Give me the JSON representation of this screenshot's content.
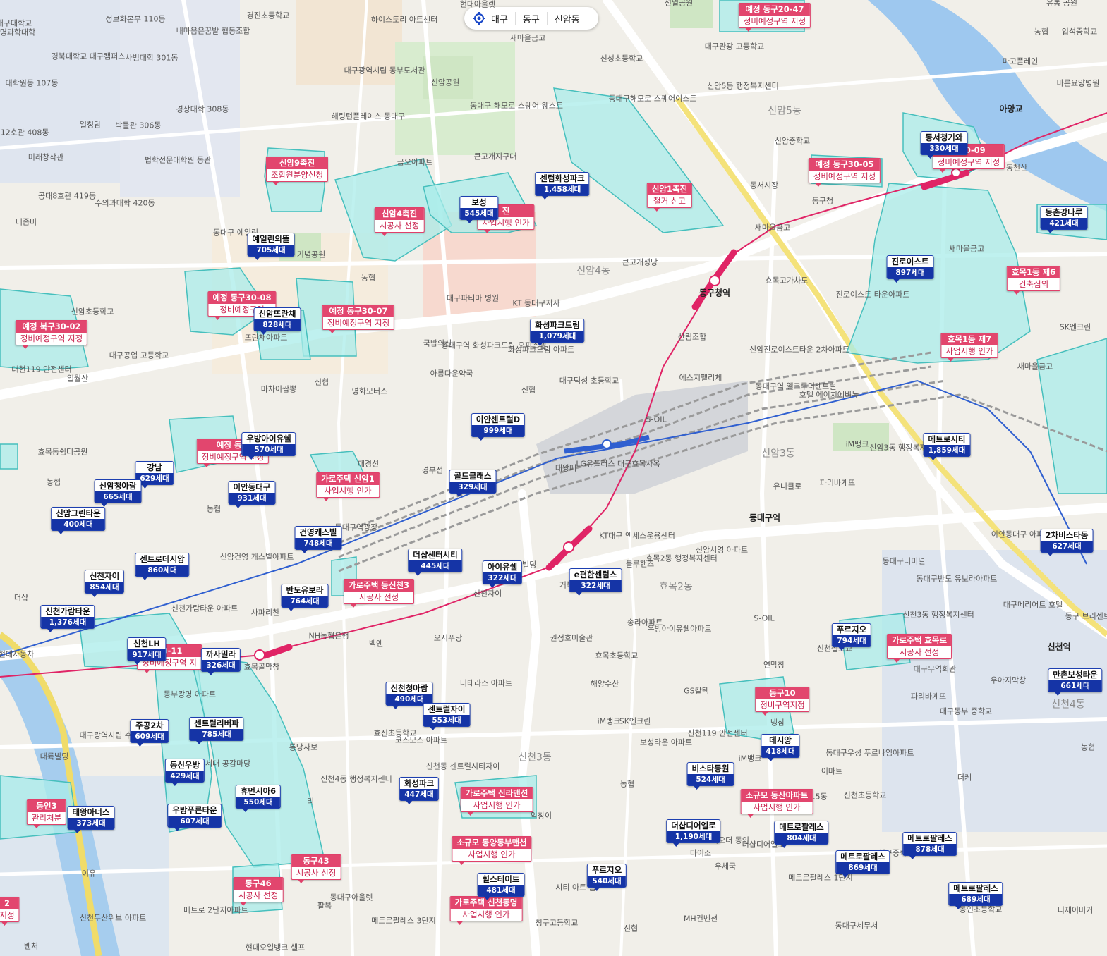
{
  "breadcrumb": {
    "icon": "location-target-icon",
    "items": [
      "대구",
      "동구",
      "신암동"
    ]
  },
  "colors": {
    "zone_fill": "#a9ecea",
    "zone_stroke": "#46bfbd",
    "apartment_marker": "#1534a6",
    "redevelopment_marker": "#e2466e",
    "rail_line": "#e02466",
    "metro_line": "#2f5fd0"
  },
  "apartments": [
    {
      "name": "동서청기와",
      "units": "330세대"
    },
    {
      "name": "센텀화성파크",
      "units": "1,458세대"
    },
    {
      "name": "보성",
      "units": "545세대"
    },
    {
      "name": "예일린의뜰",
      "units": "705세대"
    },
    {
      "name": "동촌강나루",
      "units": "421세대"
    },
    {
      "name": "진로이스트",
      "units": "897세대"
    },
    {
      "name": "신암뜨란채",
      "units": "828세대"
    },
    {
      "name": "화성파크드림",
      "units": "1,079세대"
    },
    {
      "name": "이안센트럴D",
      "units": "999세대"
    },
    {
      "name": "우방아이유쉘",
      "units": "570세대"
    },
    {
      "name": "강남",
      "units": "629세대"
    },
    {
      "name": "신암청아람",
      "units": "665세대"
    },
    {
      "name": "이안동대구",
      "units": "931세대"
    },
    {
      "name": "골드클래스",
      "units": "329세대"
    },
    {
      "name": "메트로시티",
      "units": "1,859세대"
    },
    {
      "name": "신암그린타운",
      "units": "400세대"
    },
    {
      "name": "건영캐스빌",
      "units": "748세대"
    },
    {
      "name": "2차비스타동",
      "units": "627세대"
    },
    {
      "name": "센트로데시앙",
      "units": "860세대"
    },
    {
      "name": "더샵센터시티",
      "units": "445세대"
    },
    {
      "name": "아이유쉘",
      "units": "322세대"
    },
    {
      "name": "e편한센텀스",
      "units": "322세대"
    },
    {
      "name": "신천자이",
      "units": "854세대"
    },
    {
      "name": "반도유보라",
      "units": "764세대"
    },
    {
      "name": "신천가람타운",
      "units": "1,376세대"
    },
    {
      "name": "푸르지오",
      "units": "794세대"
    },
    {
      "name": "신천LH",
      "units": "917세대"
    },
    {
      "name": "까사밀라",
      "units": "326세대"
    },
    {
      "name": "만촌보성타운",
      "units": "661세대"
    },
    {
      "name": "신천청아람",
      "units": "490세대"
    },
    {
      "name": "센트럴자이",
      "units": "553세대"
    },
    {
      "name": "주공2차",
      "units": "609세대"
    },
    {
      "name": "센트럴리버파",
      "units": "785세대"
    },
    {
      "name": "데시앙",
      "units": "418세대"
    },
    {
      "name": "동신우방",
      "units": "429세대"
    },
    {
      "name": "비스타동원",
      "units": "524세대"
    },
    {
      "name": "화성파크",
      "units": "447세대"
    },
    {
      "name": "휴먼시아6",
      "units": "550세대"
    },
    {
      "name": "태왕아너스",
      "units": "373세대"
    },
    {
      "name": "우방푸른타운",
      "units": "607세대"
    },
    {
      "name": "더샵디어엘로",
      "units": "1,190세대"
    },
    {
      "name": "메트로팔레스",
      "units": "804세대"
    },
    {
      "name": "메트로팔레스",
      "units": "878세대"
    },
    {
      "name": "메트로팔레스",
      "units": "869세대"
    },
    {
      "name": "푸르지오",
      "units": "540세대"
    },
    {
      "name": "힐스테이트",
      "units": "481세대"
    },
    {
      "name": "메트로팔레스",
      "units": "689세대"
    }
  ],
  "redevelopment": [
    {
      "name": "예정 동구20-47",
      "status": "정비예정구역 지정"
    },
    {
      "name": "신암9촉진",
      "status": "조합원분양신청"
    },
    {
      "name": "예정 동구30-05",
      "status": "정비예정구역 지정"
    },
    {
      "name": "구30-09",
      "status": "정비예정구역 지정"
    },
    {
      "name": "신암1촉진",
      "status": "철거 신고"
    },
    {
      "name": "신암4촉진",
      "status": "시공사 선정"
    },
    {
      "name": "진",
      "status": "사업시행 인가"
    },
    {
      "name": "효목1동 제6",
      "status": "건축심의"
    },
    {
      "name": "예정 동구30-08",
      "status": "정비예정구역"
    },
    {
      "name": "예정 동구30-07",
      "status": "정비예정구역 지정"
    },
    {
      "name": "예정 북구30-02",
      "status": "정비예정구역 지정"
    },
    {
      "name": "효목1동 제7",
      "status": "사업시행 인가"
    },
    {
      "name": "예정 동구",
      "status": "정비예정구역 지정"
    },
    {
      "name": "가로주택 신암1",
      "status": "사업시행 인가"
    },
    {
      "name": "가로주택 동신천3",
      "status": "시공사 선정"
    },
    {
      "name": "가로주택 효목로",
      "status": "시공사 선정"
    },
    {
      "name": "30-11",
      "status": "정비예정구역 지"
    },
    {
      "name": "동구10",
      "status": "정비구역지정"
    },
    {
      "name": "소규모 동산아파트",
      "status": "사업시행 인가"
    },
    {
      "name": "가로주택 신라맨션",
      "status": "사업시행 인가"
    },
    {
      "name": "동인3",
      "status": "관리처분"
    },
    {
      "name": "소규모 동양동부맨션",
      "status": "사업시행 인가"
    },
    {
      "name": "동구43",
      "status": "시공사 선정"
    },
    {
      "name": "동구46",
      "status": "시공사 선정"
    },
    {
      "name": "가로주택 신천동명",
      "status": "사업시행 인가"
    },
    {
      "name": "2",
      "status": "지정"
    }
  ],
  "places": [
    "정보화본부 110동",
    "경진초등학교",
    "하이스토리 아트센터",
    "현대아울렛",
    "선열공원",
    "유통 공원",
    "대구대학교 ",
    "명과학대학",
    "내마음은꿈밭 협동조합",
    "새마을금고",
    "신성초등학교",
    "대구관광 고등학교",
    "농협",
    "입석중학교",
    "경북대학교 대구캠퍼스",
    "사범대학 301동",
    "대구광역시립 동부도서관",
    "신암공원",
    "동대구 해모로 스퀘어 웨스트",
    "동대구해모로 스퀘어이스트",
    "신암5동 행정복지센터",
    "마고플레인",
    "바른요양병원",
    "대학원동 107동",
    "경상대학 308동",
    "해링턴플레이스 동대구",
    "신암5동",
    "아양교",
    "공대12호관 408동",
    "일청담",
    "박물관 306동",
    "법학전문대학원 동관",
    "금오아파트",
    "큰고개지구대",
    "동서시장",
    "신암중학교",
    "동구청",
    "동천산",
    "미래창작관",
    "공대8호관 419동",
    "수의과대학 420동",
    "더좀비",
    "동대구 예일린",
    "새마을금고",
    "새마을금고",
    "기념공원",
    "신암4동",
    "큰고개성당",
    "농협",
    "대구파티마 병원",
    "KT 동대구지사",
    "동구청역",
    "효목고가차도",
    "진로이스트 타운아파트",
    "SK엔크린",
    "신암초등학교",
    "국밥의신",
    "동대구역 화성파크드림 오피스텔",
    "화성파크드림 아파트",
    "산림조합",
    "대구공업 고등학교",
    "뜨란채아파트",
    "신암진로이스트타운 2차아파트",
    "새마을금고",
    "대현119 안전센터",
    "일월산",
    "마차이짬뽕",
    "신협",
    "영화모터스",
    "아름다운약국",
    "신협",
    "대구덕성 초등학교",
    "에스지펠리체",
    "S-OIL",
    "iM뱅크",
    "동대구역 엘크루더센트럴",
    "호텔 에이치에비뉴",
    "효목동쉼터공원",
    "대경선",
    "경부선",
    "농협",
    "신암3동",
    "신암3동 행정복지센터",
    "파리바게뜨",
    "유니클로",
    "태왕메",
    "LG유플러스 대구효목사옥",
    "농협",
    "동대구역광장",
    "동대구역",
    "이안동대구 아파트",
    "신암건영 캐스빌아파트",
    "KT대구 엑세스운용센터",
    "효목2동 행정복지센터",
    "신암시영 아파트",
    "동대구터미널",
    "대한빌딩",
    "블루핸즈",
    "효목2동",
    "더샵",
    "거북이동네",
    "사파리찬",
    "신천가람타운 아파트",
    "신천자이",
    "동대구반도 유보라아파트",
    "송라아파트",
    "우방아이유쉘아파트",
    "NH농협은행",
    "백엔",
    "오시푸당",
    "권정호미술관",
    "S-OIL",
    "신천3동 행정복지센터",
    "대구메리어트 호텔",
    "현대자동차",
    "효목골막창",
    "효목초등학교",
    "신천철도교",
    "신천역",
    "연막창",
    "동구 브리센트아파트",
    "더테라스 아파트",
    "해양수산",
    "GS칼텍",
    "대구무역회관",
    "우아지막창",
    "동부광명 아파트",
    "iM뱅크",
    "SK엔크린",
    "파리바게뜨",
    "냉삼",
    "신천4동",
    "농협",
    "신천119 안전센터",
    "보성타운 아파트",
    "대구동부 중학교",
    "효신초등학교",
    "코스모스 아파트",
    "통당사보",
    "신천3동",
    "신천동 센트럴시티자이",
    "iM뱅크",
    "동대구우성 푸르나임아파트",
    "농협",
    "더케",
    "대륙빌딩",
    "신천4동 행정복지센터",
    "대구광역시립 수성도서관",
    "동신세대 공감마당",
    "신천초등학교",
    "리",
    "2.5동",
    "이마트",
    "악창이",
    "이유",
    "다이소",
    "동대구아울렛",
    "리오더 동인",
    "더샵디어엘로",
    "청구중학교",
    "우체국",
    "메트로팔레스 1단지",
    "메트로팔레스 3단지",
    "팔복",
    "메트로 2단지아파트",
    "신천두산위브 아파트",
    "청구고등학교",
    "신협",
    "시티 아트 홈",
    "MH컨벤션",
    "동대구세무서",
    "벤처",
    "현대오일뱅크 셀프",
    "티제이버거",
    "동인초등학교",
    "파휘향",
    "마콘",
    "메트로 5단지아파트"
  ]
}
